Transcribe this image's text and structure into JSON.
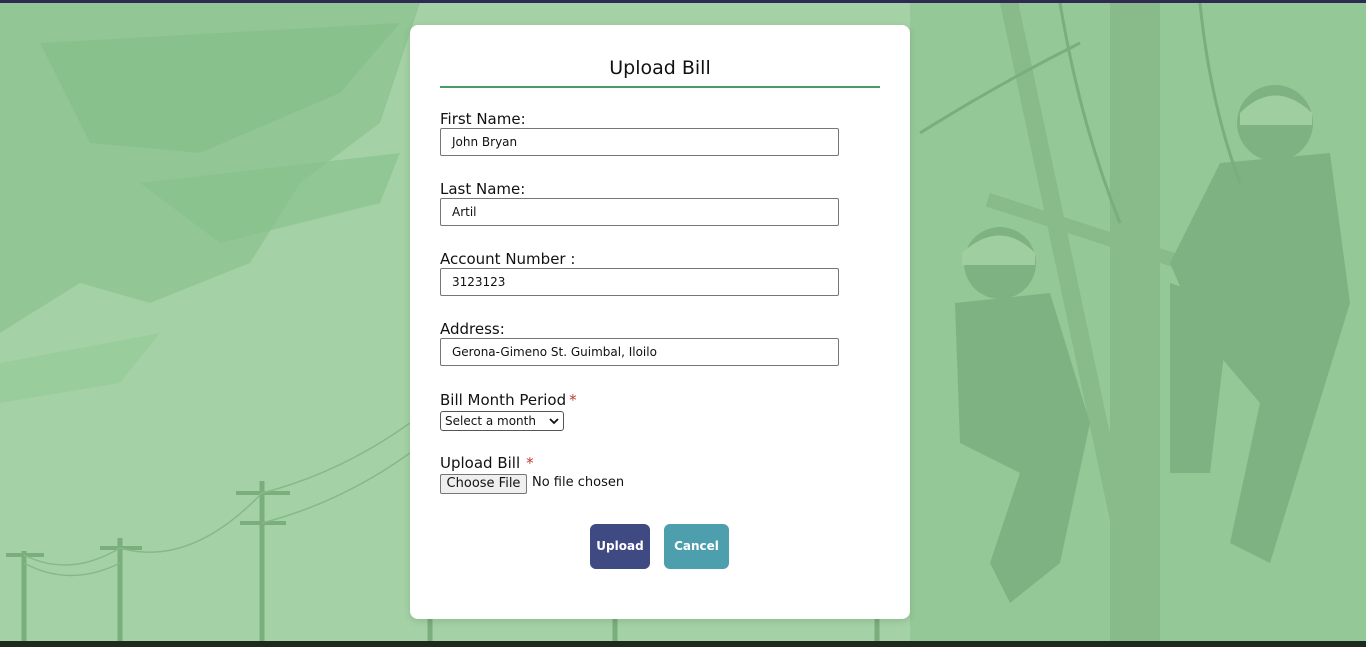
{
  "form": {
    "title": "Upload Bill",
    "fields": [
      {
        "label": "First Name:",
        "value": "John Bryan"
      },
      {
        "label": "Last Name:",
        "value": "Artil"
      },
      {
        "label": "Account Number :",
        "value": "3123123"
      },
      {
        "label": "Address:",
        "value": "Gerona-Gimeno St. Guimbal, Iloilo"
      }
    ],
    "bill_month": {
      "label": "Bill Month Period",
      "required_mark": "*",
      "selected": "Select a month"
    },
    "upload": {
      "label": "Upload Bill",
      "required_mark": "*",
      "button_label": "Choose File",
      "status": "No file chosen"
    },
    "buttons": {
      "upload_label": "Upload",
      "cancel_label": "Cancel"
    }
  },
  "colors": {
    "background": "#a4d2a6",
    "title_rule": "#4a9a68",
    "upload_button": "#3f4a82",
    "cancel_button": "#4d9fad",
    "required": "#c0392b"
  },
  "icons": {
    "select_arrow": "chevron-down-icon"
  }
}
